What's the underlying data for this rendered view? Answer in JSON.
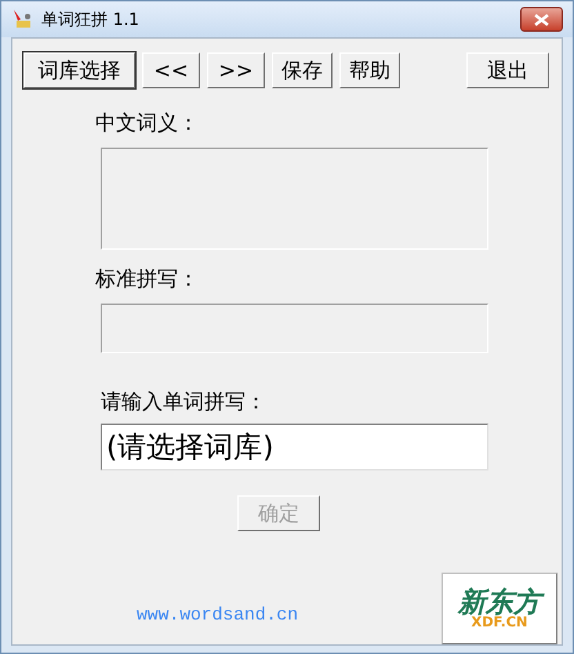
{
  "window": {
    "title": "单词狂拼 1.1"
  },
  "toolbar": [
    {
      "label": "词库选择",
      "kind": "default"
    },
    {
      "label": "<<",
      "kind": "normal"
    },
    {
      "label": ">>",
      "kind": "normal"
    },
    {
      "label": "保存",
      "kind": "normal"
    },
    {
      "label": "帮助",
      "kind": "normal"
    },
    {
      "label": "退出",
      "kind": "exit"
    }
  ],
  "meaning": {
    "label": "中文词义："
  },
  "standard_spelling": {
    "label": "标准拼写："
  },
  "input": {
    "label": "请输入单词拼写：",
    "value": "(请选择词库)"
  },
  "confirm_button": {
    "label": "确定",
    "disabled": true
  },
  "footer": {
    "link": "www.wordsand.cn",
    "logo": {
      "name": "新东方",
      "sub": "XDF.CN"
    }
  }
}
